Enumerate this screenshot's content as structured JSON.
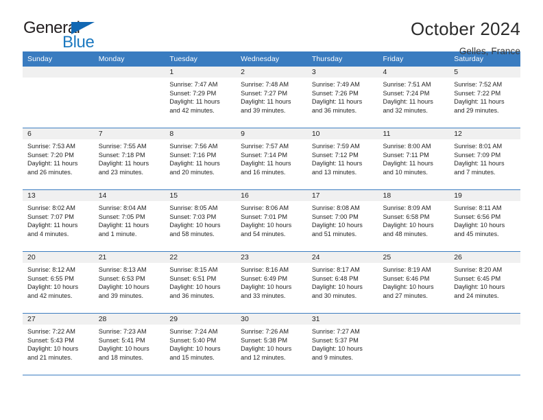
{
  "logo": {
    "word_top": "General",
    "word_bottom": "Blue",
    "triangle": "triangle-icon",
    "colors": {
      "dark": "#231f20",
      "blue": "#1c79c0"
    }
  },
  "header": {
    "title": "October 2024",
    "subtitle": "Gelles, France"
  },
  "theme": {
    "header_bg": "#3a7cc0",
    "header_text": "#ffffff",
    "daynum_bg": "#f0f0f0",
    "rule": "#3a7cc0"
  },
  "weekday_headers": [
    "Sunday",
    "Monday",
    "Tuesday",
    "Wednesday",
    "Thursday",
    "Friday",
    "Saturday"
  ],
  "labels": {
    "sunrise_prefix": "Sunrise:",
    "sunset_prefix": "Sunset:",
    "daylight_prefix": "Daylight:"
  },
  "weeks": [
    [
      {
        "day": "",
        "blank": true
      },
      {
        "day": "",
        "blank": true
      },
      {
        "day": "1",
        "sunrise": "Sunrise: 7:47 AM",
        "sunset": "Sunset: 7:29 PM",
        "daylight_l1": "Daylight: 11 hours",
        "daylight_l2": "and 42 minutes."
      },
      {
        "day": "2",
        "sunrise": "Sunrise: 7:48 AM",
        "sunset": "Sunset: 7:27 PM",
        "daylight_l1": "Daylight: 11 hours",
        "daylight_l2": "and 39 minutes."
      },
      {
        "day": "3",
        "sunrise": "Sunrise: 7:49 AM",
        "sunset": "Sunset: 7:26 PM",
        "daylight_l1": "Daylight: 11 hours",
        "daylight_l2": "and 36 minutes."
      },
      {
        "day": "4",
        "sunrise": "Sunrise: 7:51 AM",
        "sunset": "Sunset: 7:24 PM",
        "daylight_l1": "Daylight: 11 hours",
        "daylight_l2": "and 32 minutes."
      },
      {
        "day": "5",
        "sunrise": "Sunrise: 7:52 AM",
        "sunset": "Sunset: 7:22 PM",
        "daylight_l1": "Daylight: 11 hours",
        "daylight_l2": "and 29 minutes."
      }
    ],
    [
      {
        "day": "6",
        "sunrise": "Sunrise: 7:53 AM",
        "sunset": "Sunset: 7:20 PM",
        "daylight_l1": "Daylight: 11 hours",
        "daylight_l2": "and 26 minutes."
      },
      {
        "day": "7",
        "sunrise": "Sunrise: 7:55 AM",
        "sunset": "Sunset: 7:18 PM",
        "daylight_l1": "Daylight: 11 hours",
        "daylight_l2": "and 23 minutes."
      },
      {
        "day": "8",
        "sunrise": "Sunrise: 7:56 AM",
        "sunset": "Sunset: 7:16 PM",
        "daylight_l1": "Daylight: 11 hours",
        "daylight_l2": "and 20 minutes."
      },
      {
        "day": "9",
        "sunrise": "Sunrise: 7:57 AM",
        "sunset": "Sunset: 7:14 PM",
        "daylight_l1": "Daylight: 11 hours",
        "daylight_l2": "and 16 minutes."
      },
      {
        "day": "10",
        "sunrise": "Sunrise: 7:59 AM",
        "sunset": "Sunset: 7:12 PM",
        "daylight_l1": "Daylight: 11 hours",
        "daylight_l2": "and 13 minutes."
      },
      {
        "day": "11",
        "sunrise": "Sunrise: 8:00 AM",
        "sunset": "Sunset: 7:11 PM",
        "daylight_l1": "Daylight: 11 hours",
        "daylight_l2": "and 10 minutes."
      },
      {
        "day": "12",
        "sunrise": "Sunrise: 8:01 AM",
        "sunset": "Sunset: 7:09 PM",
        "daylight_l1": "Daylight: 11 hours",
        "daylight_l2": "and 7 minutes."
      }
    ],
    [
      {
        "day": "13",
        "sunrise": "Sunrise: 8:02 AM",
        "sunset": "Sunset: 7:07 PM",
        "daylight_l1": "Daylight: 11 hours",
        "daylight_l2": "and 4 minutes."
      },
      {
        "day": "14",
        "sunrise": "Sunrise: 8:04 AM",
        "sunset": "Sunset: 7:05 PM",
        "daylight_l1": "Daylight: 11 hours",
        "daylight_l2": "and 1 minute."
      },
      {
        "day": "15",
        "sunrise": "Sunrise: 8:05 AM",
        "sunset": "Sunset: 7:03 PM",
        "daylight_l1": "Daylight: 10 hours",
        "daylight_l2": "and 58 minutes."
      },
      {
        "day": "16",
        "sunrise": "Sunrise: 8:06 AM",
        "sunset": "Sunset: 7:01 PM",
        "daylight_l1": "Daylight: 10 hours",
        "daylight_l2": "and 54 minutes."
      },
      {
        "day": "17",
        "sunrise": "Sunrise: 8:08 AM",
        "sunset": "Sunset: 7:00 PM",
        "daylight_l1": "Daylight: 10 hours",
        "daylight_l2": "and 51 minutes."
      },
      {
        "day": "18",
        "sunrise": "Sunrise: 8:09 AM",
        "sunset": "Sunset: 6:58 PM",
        "daylight_l1": "Daylight: 10 hours",
        "daylight_l2": "and 48 minutes."
      },
      {
        "day": "19",
        "sunrise": "Sunrise: 8:11 AM",
        "sunset": "Sunset: 6:56 PM",
        "daylight_l1": "Daylight: 10 hours",
        "daylight_l2": "and 45 minutes."
      }
    ],
    [
      {
        "day": "20",
        "sunrise": "Sunrise: 8:12 AM",
        "sunset": "Sunset: 6:55 PM",
        "daylight_l1": "Daylight: 10 hours",
        "daylight_l2": "and 42 minutes."
      },
      {
        "day": "21",
        "sunrise": "Sunrise: 8:13 AM",
        "sunset": "Sunset: 6:53 PM",
        "daylight_l1": "Daylight: 10 hours",
        "daylight_l2": "and 39 minutes."
      },
      {
        "day": "22",
        "sunrise": "Sunrise: 8:15 AM",
        "sunset": "Sunset: 6:51 PM",
        "daylight_l1": "Daylight: 10 hours",
        "daylight_l2": "and 36 minutes."
      },
      {
        "day": "23",
        "sunrise": "Sunrise: 8:16 AM",
        "sunset": "Sunset: 6:49 PM",
        "daylight_l1": "Daylight: 10 hours",
        "daylight_l2": "and 33 minutes."
      },
      {
        "day": "24",
        "sunrise": "Sunrise: 8:17 AM",
        "sunset": "Sunset: 6:48 PM",
        "daylight_l1": "Daylight: 10 hours",
        "daylight_l2": "and 30 minutes."
      },
      {
        "day": "25",
        "sunrise": "Sunrise: 8:19 AM",
        "sunset": "Sunset: 6:46 PM",
        "daylight_l1": "Daylight: 10 hours",
        "daylight_l2": "and 27 minutes."
      },
      {
        "day": "26",
        "sunrise": "Sunrise: 8:20 AM",
        "sunset": "Sunset: 6:45 PM",
        "daylight_l1": "Daylight: 10 hours",
        "daylight_l2": "and 24 minutes."
      }
    ],
    [
      {
        "day": "27",
        "sunrise": "Sunrise: 7:22 AM",
        "sunset": "Sunset: 5:43 PM",
        "daylight_l1": "Daylight: 10 hours",
        "daylight_l2": "and 21 minutes."
      },
      {
        "day": "28",
        "sunrise": "Sunrise: 7:23 AM",
        "sunset": "Sunset: 5:41 PM",
        "daylight_l1": "Daylight: 10 hours",
        "daylight_l2": "and 18 minutes."
      },
      {
        "day": "29",
        "sunrise": "Sunrise: 7:24 AM",
        "sunset": "Sunset: 5:40 PM",
        "daylight_l1": "Daylight: 10 hours",
        "daylight_l2": "and 15 minutes."
      },
      {
        "day": "30",
        "sunrise": "Sunrise: 7:26 AM",
        "sunset": "Sunset: 5:38 PM",
        "daylight_l1": "Daylight: 10 hours",
        "daylight_l2": "and 12 minutes."
      },
      {
        "day": "31",
        "sunrise": "Sunrise: 7:27 AM",
        "sunset": "Sunset: 5:37 PM",
        "daylight_l1": "Daylight: 10 hours",
        "daylight_l2": "and 9 minutes."
      },
      {
        "day": "",
        "blank": true
      },
      {
        "day": "",
        "blank": true
      }
    ]
  ]
}
